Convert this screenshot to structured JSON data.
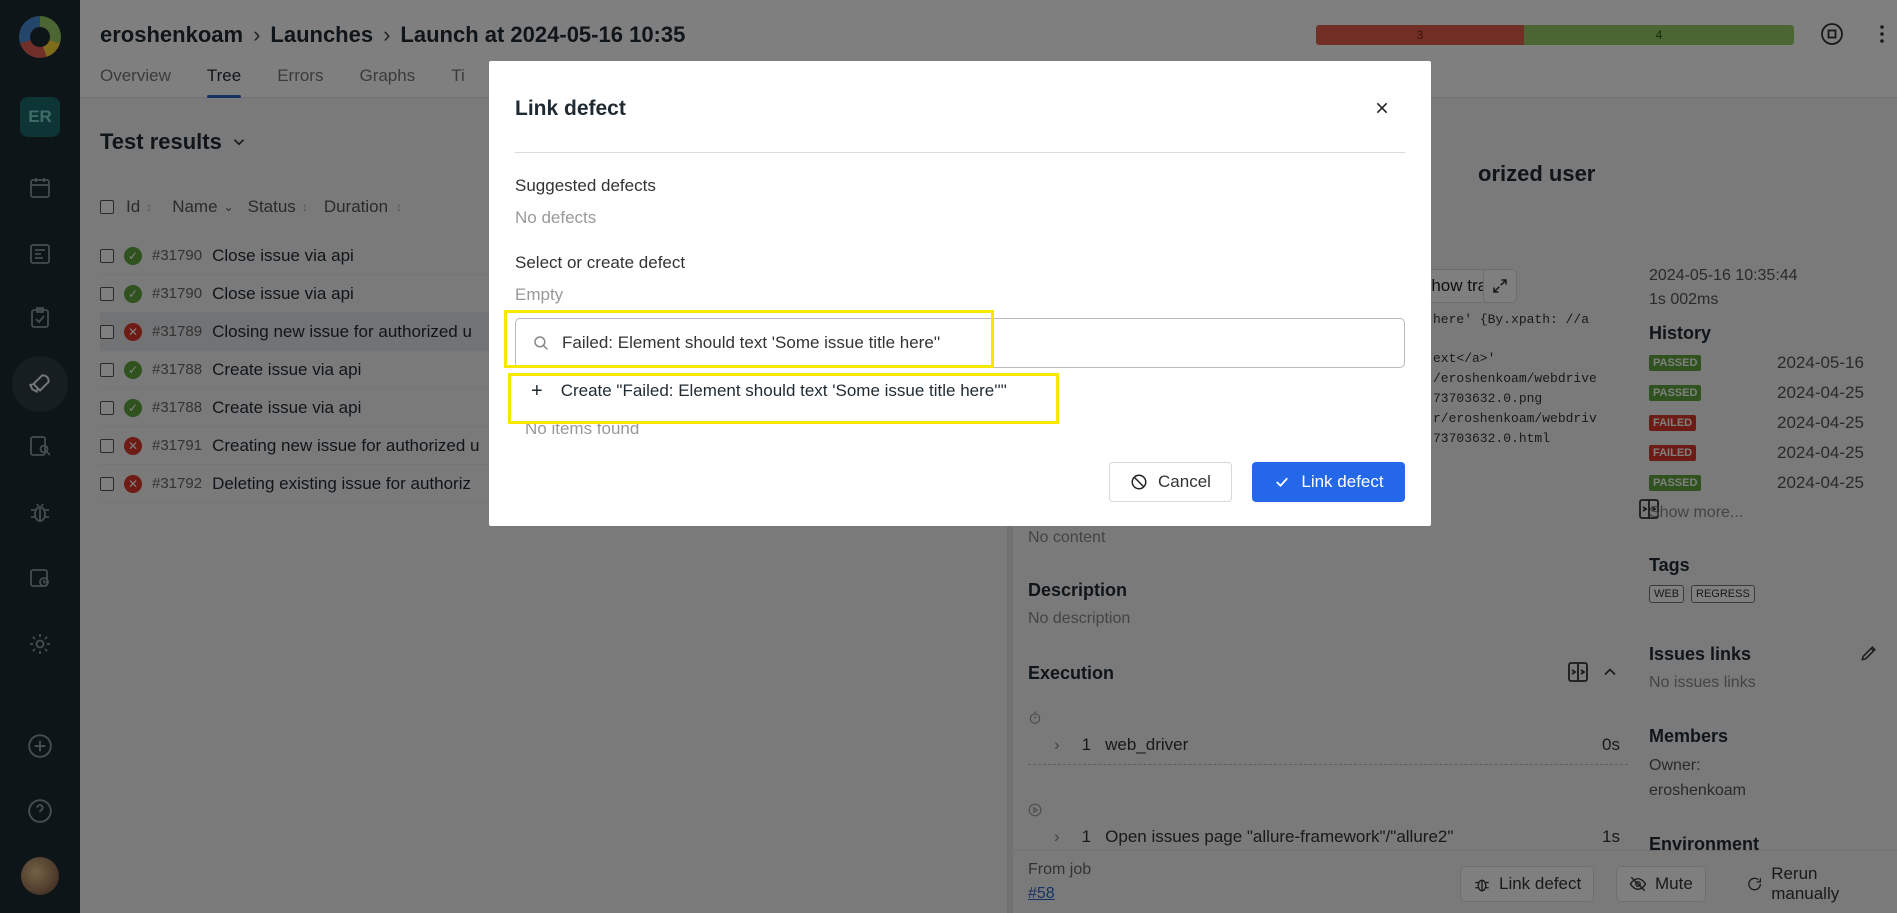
{
  "sidebar": {
    "project_initials": "ER"
  },
  "header": {
    "breadcrumb": [
      "eroshenkoam",
      "Launches",
      "Launch at 2024-05-16 10:35"
    ],
    "tabs": [
      "Overview",
      "Tree",
      "Errors",
      "Graphs",
      "Ti"
    ],
    "stats": {
      "failed": "3",
      "passed": "4"
    }
  },
  "tree": {
    "title": "Test results",
    "columns": {
      "id": "Id",
      "name": "Name",
      "status": "Status",
      "duration": "Duration"
    },
    "rows": [
      {
        "id": "#31790",
        "name": "Close issue via api",
        "status": "passed"
      },
      {
        "id": "#31790",
        "name": "Close issue via api",
        "status": "passed"
      },
      {
        "id": "#31789",
        "name": "Closing new issue for authorized u",
        "status": "failed"
      },
      {
        "id": "#31788",
        "name": "Create issue via api",
        "status": "passed"
      },
      {
        "id": "#31788",
        "name": "Create issue via api",
        "status": "passed"
      },
      {
        "id": "#31791",
        "name": "Creating new issue for authorized u",
        "status": "failed"
      },
      {
        "id": "#31792",
        "name": "Deleting existing issue for authoriz",
        "status": "failed"
      }
    ]
  },
  "detail": {
    "title_fragment": "orized user",
    "show_trace": "Show trace",
    "trace_lines": [
      "here' {By.xpath: //a",
      "ext</a>'",
      "/eroshenkoam/webdrive",
      "73703632.0.png",
      "r/eroshenkoam/webdriv",
      "73703632.0.html"
    ],
    "timestamp": "2024-05-16 10:35:44",
    "duration": "1s 002ms",
    "history": {
      "label": "History",
      "items": [
        {
          "status": "PASSED",
          "date": "2024-05-16"
        },
        {
          "status": "PASSED",
          "date": "2024-04-25"
        },
        {
          "status": "FAILED",
          "date": "2024-04-25"
        },
        {
          "status": "FAILED",
          "date": "2024-04-25"
        },
        {
          "status": "PASSED",
          "date": "2024-04-25"
        }
      ],
      "show_more": "Show more..."
    },
    "no_content": "No content",
    "description_label": "Description",
    "description_value": "No description",
    "execution_label": "Execution",
    "steps": [
      {
        "num": "1",
        "name": "web_driver",
        "time": "0s"
      },
      {
        "num": "1",
        "name": "Open issues page \"allure-framework\"/\"allure2\"",
        "time": "1s"
      }
    ],
    "from_job_label": "From job",
    "from_job_link": "#58",
    "tags_label": "Tags",
    "tags": [
      "WEB",
      "REGRESS"
    ],
    "issues_label": "Issues links",
    "issues_value": "No issues links",
    "members_label": "Members",
    "owner_label": "Owner:",
    "owner_value": "eroshenkoam",
    "environment_label": "Environment",
    "footer": {
      "link_defect": "Link defect",
      "mute": "Mute",
      "rerun": "Rerun manually"
    }
  },
  "modal": {
    "title": "Link defect",
    "suggested_label": "Suggested defects",
    "suggested_value": "No defects",
    "select_label": "Select or create defect",
    "select_value": "Empty",
    "search_value": "Failed: Element should text 'Some issue title here''",
    "create_option": "Create \"Failed: Element should text 'Some issue title here''\"",
    "no_items": "No items found",
    "cancel": "Cancel",
    "submit": "Link defect",
    "accent_color": "#2467e8",
    "highlight_color": "#f7e800"
  }
}
